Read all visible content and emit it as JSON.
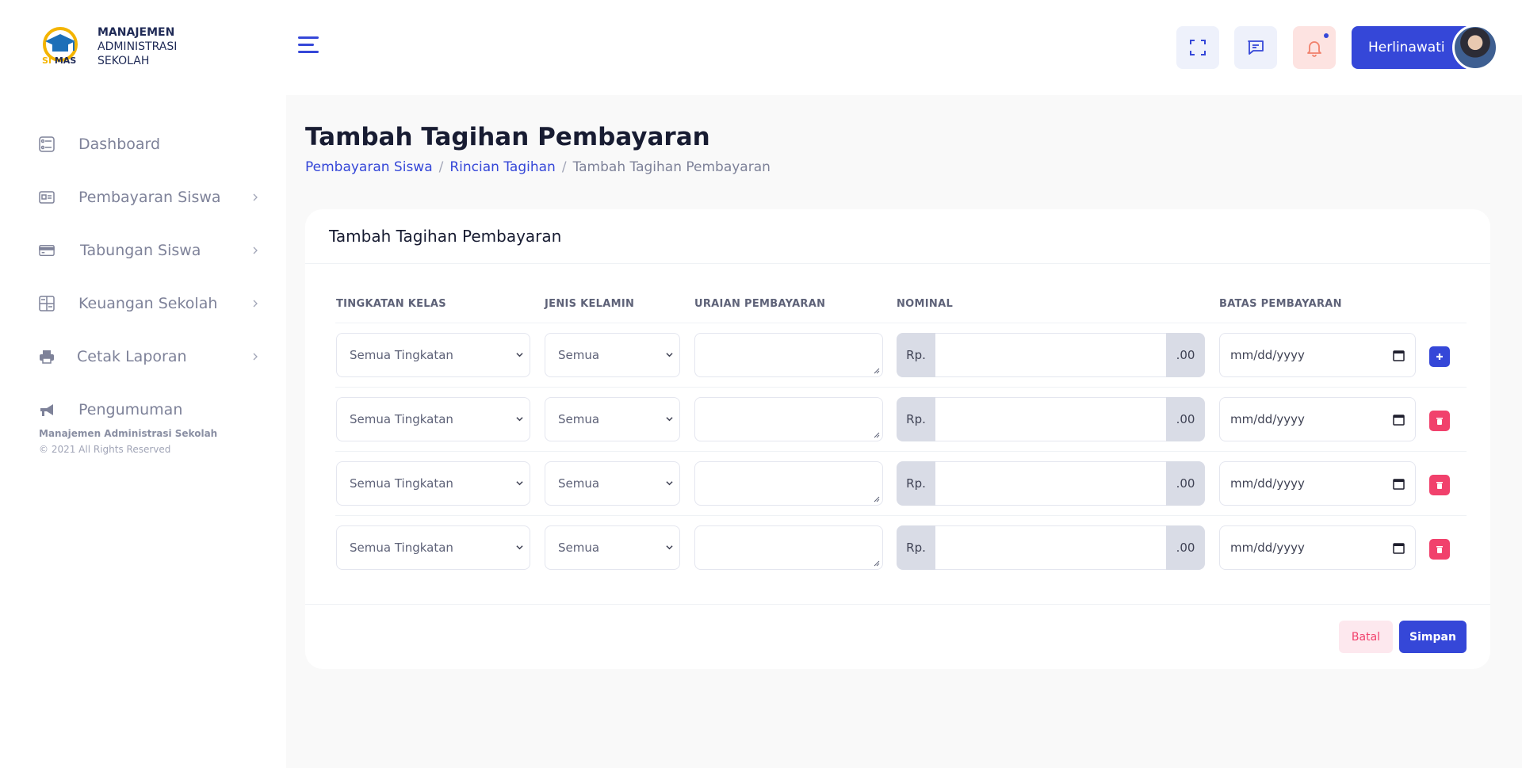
{
  "brand": {
    "logo_text": "SI MAS",
    "line1": "MANAJEMEN",
    "line2": "ADMINISTRASI",
    "line3": "SEKOLAH"
  },
  "sidebar": {
    "items": [
      {
        "label": "Dashboard",
        "icon": "dashboard-icon",
        "has_submenu": false
      },
      {
        "label": "Pembayaran Siswa",
        "icon": "id-card-icon",
        "has_submenu": true
      },
      {
        "label": "Tabungan Siswa",
        "icon": "credit-card-icon",
        "has_submenu": true
      },
      {
        "label": "Keuangan Sekolah",
        "icon": "calculator-icon",
        "has_submenu": true
      },
      {
        "label": "Cetak Laporan",
        "icon": "printer-icon",
        "has_submenu": true
      },
      {
        "label": "Pengumuman",
        "icon": "megaphone-icon",
        "has_submenu": false
      }
    ],
    "footer_title": "Manajemen Administrasi Sekolah",
    "footer_copy": "© 2021 All Rights Reserved"
  },
  "header": {
    "user_name": "Herlinawati"
  },
  "page": {
    "title": "Tambah Tagihan Pembayaran",
    "breadcrumb": [
      "Pembayaran Siswa",
      "Rincian Tagihan",
      "Tambah Tagihan Pembayaran"
    ]
  },
  "card": {
    "title": "Tambah Tagihan Pembayaran",
    "columns": [
      "TINGKATAN KELAS",
      "JENIS KELAMIN",
      "URAIAN PEMBAYARAN",
      "NOMINAL",
      "BATAS PEMBAYARAN"
    ],
    "rows": [
      {
        "tingkatan": "Semua Tingkatan",
        "jenis_kelamin": "Semua",
        "uraian": "",
        "prefix": "Rp.",
        "nominal": "",
        "suffix": ".00",
        "batas": "mm/dd/yyyy",
        "action": "add"
      },
      {
        "tingkatan": "Semua Tingkatan",
        "jenis_kelamin": "Semua",
        "uraian": "",
        "prefix": "Rp.",
        "nominal": "",
        "suffix": ".00",
        "batas": "mm/dd/yyyy",
        "action": "delete"
      },
      {
        "tingkatan": "Semua Tingkatan",
        "jenis_kelamin": "Semua",
        "uraian": "",
        "prefix": "Rp.",
        "nominal": "",
        "suffix": ".00",
        "batas": "mm/dd/yyyy",
        "action": "delete"
      },
      {
        "tingkatan": "Semua Tingkatan",
        "jenis_kelamin": "Semua",
        "uraian": "",
        "prefix": "Rp.",
        "nominal": "",
        "suffix": ".00",
        "batas": "mm/dd/yyyy",
        "action": "delete"
      }
    ],
    "cancel_label": "Batal",
    "save_label": "Simpan"
  },
  "colors": {
    "primary": "#3547d8",
    "danger": "#f1416c",
    "background": "#f9f9f9"
  }
}
